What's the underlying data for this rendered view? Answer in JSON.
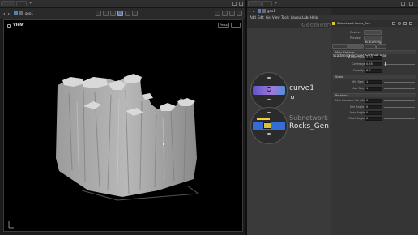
{
  "left": {
    "tabs": [
      "Scene View",
      "Ani"
    ],
    "path_node": "geo1",
    "viewport_label": "View",
    "camera_menu": "Persp"
  },
  "network": {
    "tabs": [
      "/obj/geo1",
      "Tre"
    ],
    "path_node": "geo1",
    "menu": [
      "Add",
      "Edit",
      "Go",
      "View",
      "Tools",
      "Layout",
      "Labs",
      "Help"
    ],
    "context_watermark": "Geometry",
    "nodes": [
      {
        "name": "curve1",
        "type": "",
        "color": "#5f54c8"
      },
      {
        "name": "Rocks_Gen",
        "type": "Subnetwork",
        "color": "#2d6fd6"
      }
    ]
  },
  "params": {
    "header_type": "Subnetwork",
    "header_name": "Rocks_Gen",
    "top_buttons": [
      "Scattering",
      "Scattering"
    ],
    "top_labels": [
      "Resolve",
      "Preview"
    ],
    "tabs": [
      "Scattering",
      "Fractures",
      "Sorting",
      "Clean"
    ],
    "active_tab": "Fractures",
    "sections": [
      "Main Settings",
      "Scale",
      "Rotation"
    ],
    "main_settings": [
      {
        "label": "Global Seed",
        "value": "7773"
      },
      {
        "label": "Coverage",
        "value": "0.35"
      },
      {
        "label": "Density",
        "value": "6.7"
      }
    ],
    "scale": [
      {
        "label": "Min Size",
        "value": "1"
      },
      {
        "label": "Max Size",
        "value": "1"
      }
    ],
    "rotation": [
      {
        "label": "Max Random Variation",
        "value": "0"
      },
      {
        "label": "Min Angle",
        "value": "0"
      },
      {
        "label": "Max Angle",
        "value": "0"
      },
      {
        "label": "Offset Angle",
        "value": "0"
      }
    ]
  }
}
